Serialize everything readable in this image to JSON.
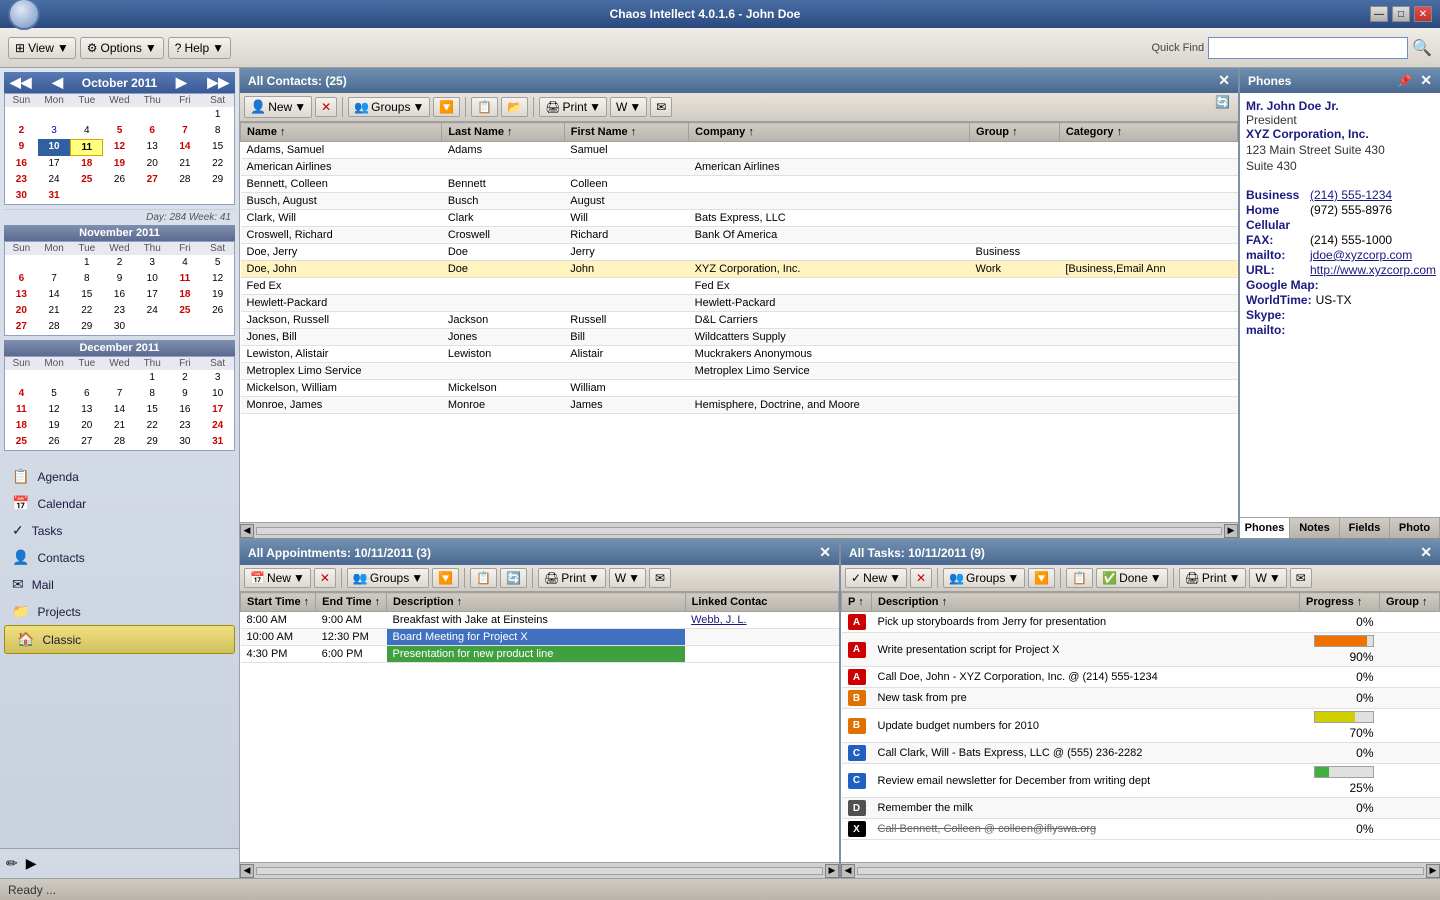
{
  "window": {
    "title": "Chaos Intellect 4.0.1.6 - John Doe",
    "min_label": "—",
    "max_label": "□",
    "close_label": "✕"
  },
  "toolbar": {
    "view_label": "View",
    "options_label": "Options",
    "help_label": "Help",
    "quick_find_label": "Quick Find",
    "quick_find_placeholder": "Quick Find"
  },
  "sidebar": {
    "nav_items": [
      {
        "id": "agenda",
        "label": "Agenda",
        "icon": "📋"
      },
      {
        "id": "calendar",
        "label": "Calendar",
        "icon": "📅"
      },
      {
        "id": "tasks",
        "label": "Tasks",
        "icon": "✓"
      },
      {
        "id": "contacts",
        "label": "Contacts",
        "icon": "👤"
      },
      {
        "id": "mail",
        "label": "Mail",
        "icon": "✉"
      },
      {
        "id": "projects",
        "label": "Projects",
        "icon": "📁"
      },
      {
        "id": "classic",
        "label": "Classic",
        "icon": "🏠",
        "active": true
      }
    ]
  },
  "calendars": [
    {
      "month": "October 2011",
      "weeks": [
        {
          "days": [
            null,
            null,
            null,
            null,
            null,
            null,
            1
          ]
        },
        {
          "days": [
            2,
            3,
            4,
            5,
            6,
            7,
            8
          ]
        },
        {
          "days": [
            9,
            "10",
            11,
            12,
            13,
            14,
            15
          ]
        },
        {
          "days": [
            16,
            17,
            18,
            19,
            20,
            21,
            22
          ]
        },
        {
          "days": [
            23,
            24,
            25,
            26,
            27,
            28,
            29
          ]
        },
        {
          "days": [
            30,
            31,
            null,
            null,
            null,
            null,
            null
          ]
        }
      ],
      "dow": [
        "Sun",
        "Mon",
        "Tue",
        "Wed",
        "Thu",
        "Fri",
        "Sat"
      ],
      "today": "11",
      "selected": "10",
      "reds": [
        2,
        9,
        16,
        23,
        30,
        6,
        13,
        20,
        27,
        11,
        18,
        25
      ],
      "day_week": "Day: 284  Week: 41"
    },
    {
      "month": "November 2011",
      "weeks": [
        {
          "days": [
            null,
            null,
            1,
            2,
            3,
            4,
            5
          ]
        },
        {
          "days": [
            6,
            7,
            8,
            9,
            10,
            11,
            12
          ]
        },
        {
          "days": [
            13,
            14,
            15,
            16,
            17,
            18,
            19
          ]
        },
        {
          "days": [
            20,
            21,
            22,
            23,
            24,
            25,
            26
          ]
        },
        {
          "days": [
            27,
            28,
            29,
            30,
            null,
            null,
            null
          ]
        }
      ],
      "dow": [
        "Sun",
        "Mon",
        "Tue",
        "Wed",
        "Thu",
        "Fri",
        "Sat"
      ],
      "reds": [
        6,
        13,
        20,
        27
      ]
    },
    {
      "month": "December 2011",
      "weeks": [
        {
          "days": [
            null,
            null,
            null,
            null,
            1,
            2,
            3
          ]
        },
        {
          "days": [
            4,
            5,
            6,
            7,
            8,
            9,
            10
          ]
        },
        {
          "days": [
            11,
            12,
            13,
            14,
            15,
            16,
            17
          ]
        },
        {
          "days": [
            18,
            19,
            20,
            21,
            22,
            23,
            24
          ]
        },
        {
          "days": [
            25,
            26,
            27,
            28,
            29,
            30,
            31
          ]
        }
      ],
      "dow": [
        "Sun",
        "Mon",
        "Tue",
        "Wed",
        "Thu",
        "Fri",
        "Sat"
      ],
      "reds": [
        4,
        11,
        18,
        25,
        17,
        24,
        31
      ]
    }
  ],
  "contacts_panel": {
    "title": "All Contacts:",
    "count": "(25)",
    "new_label": "New",
    "groups_label": "Groups",
    "print_label": "Print",
    "columns": [
      "Name",
      "Last Name",
      "First Name",
      "Company",
      "Group",
      "Category"
    ],
    "col_nums": [
      1,
      2,
      3,
      4,
      5,
      6
    ],
    "contacts": [
      {
        "name": "Adams, Samuel",
        "last": "Adams",
        "first": "Samuel",
        "company": "",
        "group": "",
        "category": ""
      },
      {
        "name": "American Airlines",
        "last": "",
        "first": "",
        "company": "American Airlines",
        "group": "",
        "category": ""
      },
      {
        "name": "Bennett, Colleen",
        "last": "Bennett",
        "first": "Colleen",
        "company": "",
        "group": "",
        "category": ""
      },
      {
        "name": "Busch, August",
        "last": "Busch",
        "first": "August",
        "company": "",
        "group": "",
        "category": ""
      },
      {
        "name": "Clark, Will",
        "last": "Clark",
        "first": "Will",
        "company": "Bats Express, LLC",
        "group": "",
        "category": ""
      },
      {
        "name": "Croswell, Richard",
        "last": "Croswell",
        "first": "Richard",
        "company": "Bank Of America",
        "group": "",
        "category": ""
      },
      {
        "name": "Doe, Jerry",
        "last": "Doe",
        "first": "Jerry",
        "company": "",
        "group": "Business",
        "category": ""
      },
      {
        "name": "Doe, John",
        "last": "Doe",
        "first": "John",
        "company": "XYZ Corporation, Inc.",
        "group": "Work",
        "category": "[Business,Email Ann",
        "selected": true
      },
      {
        "name": "Fed Ex",
        "last": "",
        "first": "",
        "company": "Fed Ex",
        "group": "",
        "category": ""
      },
      {
        "name": "Hewlett-Packard",
        "last": "",
        "first": "",
        "company": "Hewlett-Packard",
        "group": "",
        "category": ""
      },
      {
        "name": "Jackson, Russell",
        "last": "Jackson",
        "first": "Russell",
        "company": "D&L Carriers",
        "group": "",
        "category": ""
      },
      {
        "name": "Jones, Bill",
        "last": "Jones",
        "first": "Bill",
        "company": "Wildcatters Supply",
        "group": "",
        "category": ""
      },
      {
        "name": "Lewiston, Alistair",
        "last": "Lewiston",
        "first": "Alistair",
        "company": "Muckrakers Anonymous",
        "group": "",
        "category": ""
      },
      {
        "name": "Metroplex Limo Service",
        "last": "",
        "first": "",
        "company": "Metroplex Limo Service",
        "group": "",
        "category": ""
      },
      {
        "name": "Mickelson, William",
        "last": "Mickelson",
        "first": "William",
        "company": "",
        "group": "",
        "category": ""
      },
      {
        "name": "Monroe, James",
        "last": "Monroe",
        "first": "James",
        "company": "Hemisphere, Doctrine, and Moore",
        "group": "",
        "category": ""
      }
    ]
  },
  "phones_panel": {
    "title": "Phones",
    "name": "Mr. John Doe Jr.",
    "title_line": "President",
    "company": "XYZ Corporation, Inc.",
    "addr1": "123 Main Street Suite 430",
    "addr2": "Suite 430",
    "business_phone": "(214) 555-1234",
    "home_phone": "(972) 555-8976",
    "cellular": "",
    "fax": "(214) 555-1000",
    "email": "jdoe@xyzcorp.com",
    "url": "http://www.xyzcorp.com",
    "google_map": "",
    "world_time": "US-TX",
    "skype": "",
    "mailto": "",
    "tabs": [
      "Phones",
      "Notes",
      "Fields",
      "Photo"
    ]
  },
  "appointments_panel": {
    "title": "All Appointments: 10/11/2011",
    "count": "(3)",
    "new_label": "New",
    "groups_label": "Groups",
    "print_label": "Print",
    "columns": [
      "Start Time",
      "End Time",
      "Description",
      "Linked Contac"
    ],
    "col_nums": [
      1,
      2,
      3
    ],
    "appointments": [
      {
        "start": "8:00 AM",
        "end": "9:00 AM",
        "desc": "Breakfast with Jake at Einsteins",
        "linked": "Webb, J. L.",
        "color": "normal"
      },
      {
        "start": "10:00 AM",
        "end": "12:30 PM",
        "desc": "Board Meeting for Project X",
        "linked": "",
        "color": "blue"
      },
      {
        "start": "4:30 PM",
        "end": "6:00 PM",
        "desc": "Presentation for new product line",
        "linked": "",
        "color": "green"
      }
    ]
  },
  "tasks_panel": {
    "title": "All Tasks: 10/11/2011",
    "count": "(9)",
    "new_label": "New",
    "groups_label": "Groups",
    "done_label": "Done",
    "print_label": "Print",
    "columns": [
      "P",
      "Description",
      "Progress",
      "Group"
    ],
    "col_nums": [
      1,
      2,
      3,
      4
    ],
    "tasks": [
      {
        "priority": "A",
        "desc": "Pick up storyboards from Jerry for presentation",
        "progress": 0,
        "progress_label": "0%",
        "group": "",
        "strikethrough": false
      },
      {
        "priority": "A",
        "desc": "Write presentation script for Project X",
        "progress": 90,
        "progress_label": "90%",
        "group": "",
        "strikethrough": false
      },
      {
        "priority": "A",
        "desc": "Call Doe, John - XYZ Corporation, Inc. @ (214) 555-1234",
        "progress": 0,
        "progress_label": "0%",
        "group": "",
        "strikethrough": false
      },
      {
        "priority": "B",
        "desc": "New task from pre",
        "progress": 0,
        "progress_label": "0%",
        "group": "",
        "strikethrough": false
      },
      {
        "priority": "B",
        "desc": "Update budget numbers for 2010",
        "progress": 70,
        "progress_label": "70%",
        "group": "",
        "strikethrough": false
      },
      {
        "priority": "C",
        "desc": "Call Clark, Will - Bats Express, LLC @ (555) 236-2282",
        "progress": 0,
        "progress_label": "0%",
        "group": "",
        "strikethrough": false
      },
      {
        "priority": "C",
        "desc": "Review email newsletter for December from writing dept",
        "progress": 25,
        "progress_label": "25%",
        "group": "",
        "strikethrough": false
      },
      {
        "priority": "D",
        "desc": "Remember the milk",
        "progress": 0,
        "progress_label": "0%",
        "group": "",
        "strikethrough": false
      },
      {
        "priority": "X",
        "desc": "Call Bennett, Colleen @ colleen@iflyswa.org",
        "progress": 0,
        "progress_label": "0%",
        "group": "",
        "strikethrough": true
      }
    ]
  },
  "status_bar": {
    "text": "Ready ..."
  }
}
